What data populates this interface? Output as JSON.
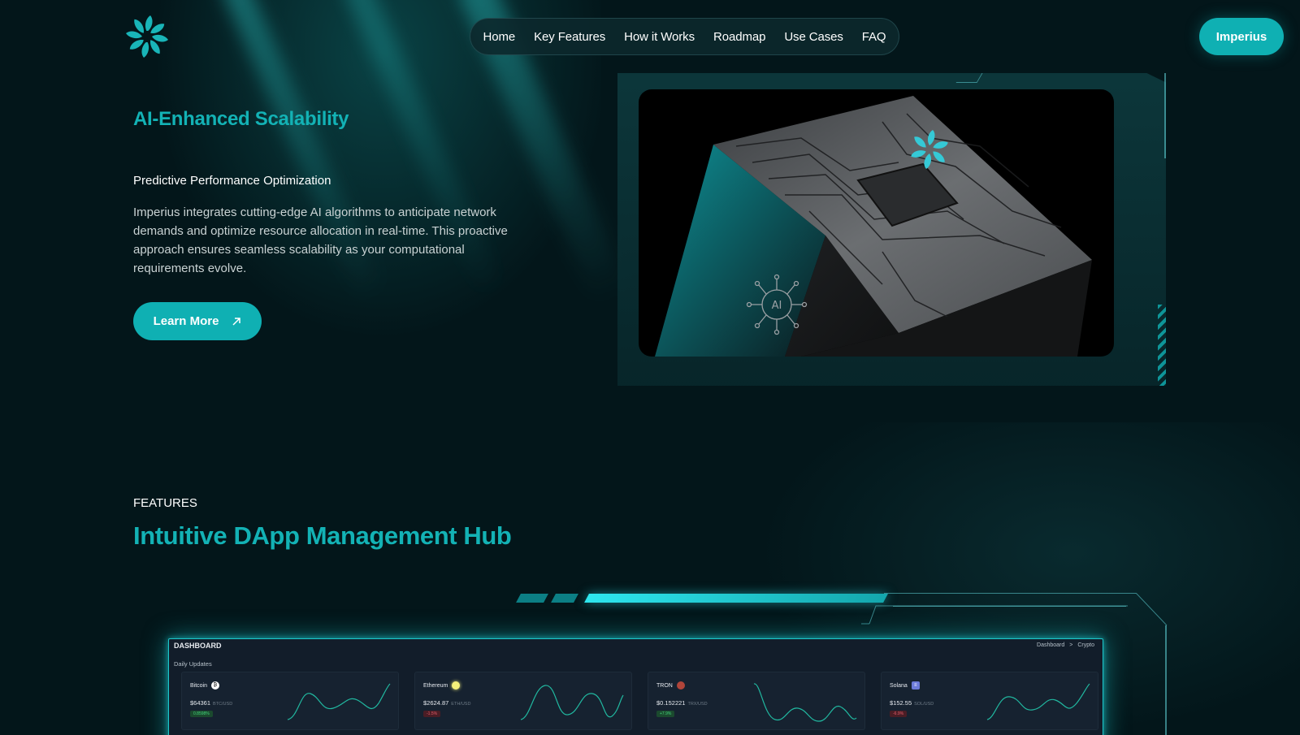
{
  "nav": {
    "items": [
      "Home",
      "Key Features",
      "How it Works",
      "Roadmap",
      "Use Cases",
      "FAQ"
    ],
    "cta": "Imperius"
  },
  "hero": {
    "title": "AI-Enhanced Scalability",
    "subtitle": "Predictive Performance Optimization",
    "body": "Imperius integrates cutting-edge AI algorithms to anticipate network demands and optimize resource allocation in real-time. This proactive approach ensures seamless scalability as your computational requirements evolve.",
    "button": "Learn More",
    "image_badge_text": "AI"
  },
  "features": {
    "label": "FEATURES",
    "title": "Intuitive DApp Management Hub"
  },
  "dashboard": {
    "title": "DASHBOARD",
    "breadcrumb": [
      "Dashboard",
      ">",
      "Crypto"
    ],
    "section": "Daily Updates",
    "cards": [
      {
        "name": "Bitcoin",
        "price": "$64361",
        "pair": "BTC/USD",
        "change": "0.8598%",
        "trend": "up",
        "coin_color": "#ffffff",
        "coin_glyph": "₿"
      },
      {
        "name": "Ethereum",
        "price": "$2624.87",
        "pair": "ETH/USD",
        "change": "-1.5%",
        "trend": "down",
        "coin_color": "#f4f07a",
        "coin_glyph": ""
      },
      {
        "name": "TRON",
        "price": "$0.152221",
        "pair": "TRX/USD",
        "change": "+7.9%",
        "trend": "up",
        "coin_color": "#b0453a",
        "coin_glyph": ""
      },
      {
        "name": "Solana",
        "price": "$152.55",
        "pair": "SOL/USD",
        "change": "-6.9%",
        "trend": "down",
        "coin_color": "#6c7bd9",
        "coin_glyph": "≡"
      }
    ]
  },
  "colors": {
    "accent": "#0fb0b3",
    "background": "#03161a"
  }
}
